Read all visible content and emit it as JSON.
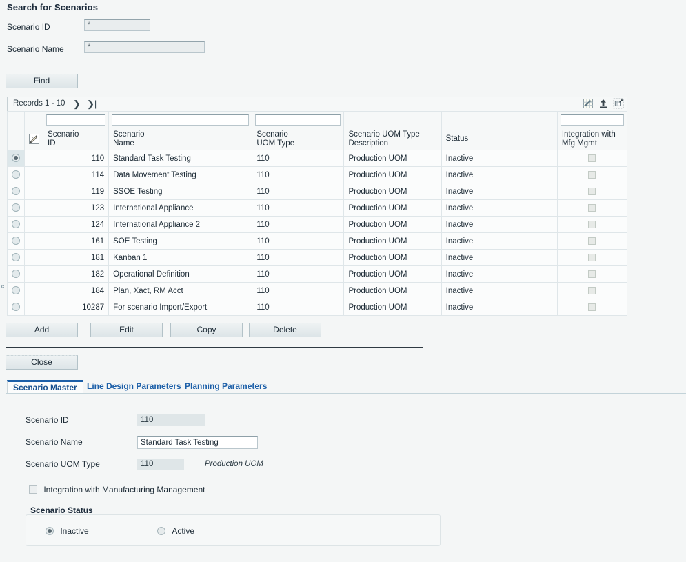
{
  "page": {
    "title": "Search for Scenarios"
  },
  "search": {
    "fields": [
      {
        "label": "Scenario ID",
        "value": "*",
        "placeholder": "*"
      },
      {
        "label": "Scenario Name",
        "value": "*",
        "placeholder": "*"
      }
    ],
    "find_label": "Find"
  },
  "grid": {
    "records_label": "Records",
    "records_range": "1 - 10",
    "nav_next_icon": "next-record-icon",
    "nav_last_icon": "last-record-icon",
    "tools": [
      {
        "name": "customize-grid-icon",
        "title": "Customize Grid"
      },
      {
        "name": "export-icon",
        "title": "Export"
      },
      {
        "name": "detach-grid-icon",
        "title": "Detach"
      }
    ],
    "filters": [
      "",
      "",
      "",
      "",
      "",
      ""
    ],
    "columns": [
      {
        "line1": "Scenario",
        "line2": "ID"
      },
      {
        "line1": "Scenario",
        "line2": "Name"
      },
      {
        "line1": "Scenario",
        "line2": "UOM Type"
      },
      {
        "line1": "Scenario UOM Type",
        "line2": "Description"
      },
      {
        "line1": "Status",
        "line2": ""
      },
      {
        "line1": "Integration with",
        "line2": "Mfg Mgmt"
      }
    ],
    "rows": [
      {
        "selected": true,
        "id": "110",
        "name": "Standard Task Testing",
        "uom_type": "110",
        "uom_desc": "Production UOM",
        "status": "Inactive",
        "integration": false
      },
      {
        "selected": false,
        "id": "114",
        "name": "Data Movement Testing",
        "uom_type": "110",
        "uom_desc": "Production UOM",
        "status": "Inactive",
        "integration": false
      },
      {
        "selected": false,
        "id": "119",
        "name": "SSOE Testing",
        "uom_type": "110",
        "uom_desc": "Production UOM",
        "status": "Inactive",
        "integration": false
      },
      {
        "selected": false,
        "id": "123",
        "name": "International Appliance",
        "uom_type": "110",
        "uom_desc": "Production UOM",
        "status": "Inactive",
        "integration": false
      },
      {
        "selected": false,
        "id": "124",
        "name": "International Appliance 2",
        "uom_type": "110",
        "uom_desc": "Production UOM",
        "status": "Inactive",
        "integration": false
      },
      {
        "selected": false,
        "id": "161",
        "name": "SOE Testing",
        "uom_type": "110",
        "uom_desc": "Production UOM",
        "status": "Inactive",
        "integration": false
      },
      {
        "selected": false,
        "id": "181",
        "name": "Kanban 1",
        "uom_type": "110",
        "uom_desc": "Production UOM",
        "status": "Inactive",
        "integration": false
      },
      {
        "selected": false,
        "id": "182",
        "name": "Operational Definition",
        "uom_type": "110",
        "uom_desc": "Production UOM",
        "status": "Inactive",
        "integration": false
      },
      {
        "selected": false,
        "id": "184",
        "name": "Plan, Xact, RM Acct",
        "uom_type": "110",
        "uom_desc": "Production UOM",
        "status": "Inactive",
        "integration": false
      },
      {
        "selected": false,
        "id": "10287",
        "name": "For scenario Import/Export",
        "uom_type": "110",
        "uom_desc": "Production UOM",
        "status": "Inactive",
        "integration": false
      }
    ]
  },
  "actions": {
    "add": "Add",
    "edit": "Edit",
    "copy": "Copy",
    "delete": "Delete",
    "close": "Close"
  },
  "tabs": [
    {
      "label": "Scenario Master",
      "active": true
    },
    {
      "label": "Line Design Parameters",
      "active": false
    },
    {
      "label": "Planning Parameters",
      "active": false
    }
  ],
  "detail": {
    "scenario_id_label": "Scenario ID",
    "scenario_id_value": "110",
    "scenario_name_label": "Scenario Name",
    "scenario_name_value": "Standard Task Testing",
    "scenario_uom_label": "Scenario UOM Type",
    "scenario_uom_value": "110",
    "scenario_uom_desc": "Production UOM",
    "integration_label": "Integration with Manufacturing Management",
    "integration_checked": false,
    "status_title": "Scenario Status",
    "status_options": [
      {
        "label": "Inactive",
        "selected": true
      },
      {
        "label": "Active",
        "selected": false
      }
    ]
  },
  "collapse_handle": "«",
  "colors": {
    "page_bg": "#f4f6f6",
    "accent_blue": "#1c5fa8",
    "grid_border": "#c6d0d4",
    "selected_row": "#dde7ea"
  }
}
